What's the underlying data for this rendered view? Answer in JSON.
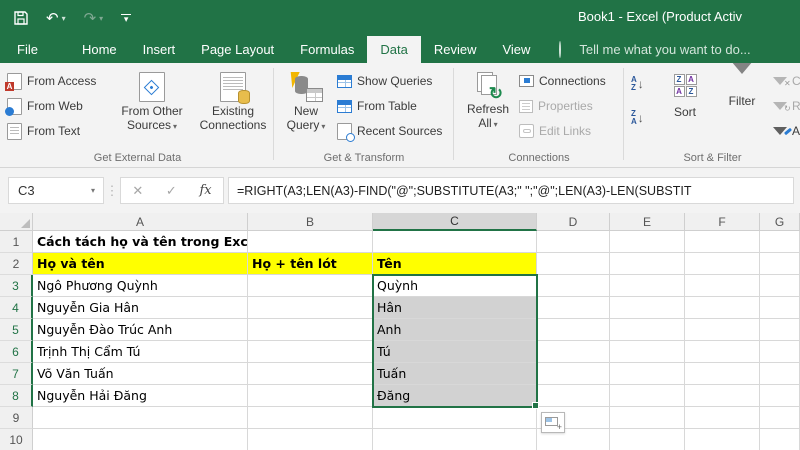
{
  "colors": {
    "accent_green": "#217346",
    "highlight_yellow": "#ffff00",
    "selection_gray": "#d2d2d2"
  },
  "window": {
    "title": "Book1 - Excel (Product Activ"
  },
  "icons": {
    "undo": "↶",
    "redo": "↷",
    "dropdown": "▾",
    "overflow_dots": "⋮",
    "cancel": "✕",
    "enter": "✓",
    "fx": "fx",
    "refresh": "↻",
    "sort_arrow": "↓",
    "letter_a": "A",
    "letter_z": "Z",
    "plus": "+",
    "clear_x": "✕"
  },
  "tabs": {
    "file": "File",
    "home": "Home",
    "insert": "Insert",
    "page_layout": "Page Layout",
    "formulas": "Formulas",
    "data": "Data",
    "review": "Review",
    "view": "View",
    "tell_me": "Tell me what you want to do..."
  },
  "ribbon": {
    "get_external": {
      "label": "Get External Data",
      "from_access": "From Access",
      "from_web": "From Web",
      "from_text": "From Text",
      "from_other_line1": "From Other",
      "from_other_line2": "Sources",
      "existing_line1": "Existing",
      "existing_line2": "Connections"
    },
    "get_transform": {
      "label": "Get & Transform",
      "new_query_line1": "New",
      "new_query_line2": "Query",
      "show_queries": "Show Queries",
      "from_table": "From Table",
      "recent_sources": "Recent Sources"
    },
    "connections": {
      "label": "Connections",
      "refresh_line1": "Refresh",
      "refresh_line2": "All",
      "connections": "Connections",
      "properties": "Properties",
      "edit_links": "Edit Links"
    },
    "sort_filter": {
      "label": "Sort & Filter",
      "sort": "Sort",
      "filter": "Filter",
      "clear": "Clear",
      "reapply": "Reapply",
      "advanced": "Advanced"
    }
  },
  "formula_bar": {
    "cell_ref": "C3",
    "formula": "=RIGHT(A3;LEN(A3)-FIND(\"@\";SUBSTITUTE(A3;\" \";\"@\";LEN(A3)-LEN(SUBSTIT"
  },
  "grid": {
    "col_headers": {
      "a": "A",
      "b": "B",
      "c": "C",
      "d": "D",
      "e": "E",
      "f": "F",
      "g": "G"
    },
    "selected_range": "C3:C8",
    "rows": [
      {
        "num": "1",
        "a": "Cách tách họ và tên trong Excel",
        "b": "",
        "c": ""
      },
      {
        "num": "2",
        "a": "Họ và tên",
        "b": "Họ + tên lót",
        "c": "Tên"
      },
      {
        "num": "3",
        "a": "Ngô Phương Quỳnh",
        "b": "",
        "c": "Quỳnh"
      },
      {
        "num": "4",
        "a": "Nguyễn Gia Hân",
        "b": "",
        "c": "Hân"
      },
      {
        "num": "5",
        "a": "Nguyễn Đào Trúc Anh",
        "b": "",
        "c": "Anh"
      },
      {
        "num": "6",
        "a": "Trịnh Thị Cẩm Tú",
        "b": "",
        "c": "Tú"
      },
      {
        "num": "7",
        "a": "Võ Văn Tuấn",
        "b": "",
        "c": "Tuấn"
      },
      {
        "num": "8",
        "a": "Nguyễn Hải Đăng",
        "b": "",
        "c": "Đăng"
      },
      {
        "num": "9",
        "a": "",
        "b": "",
        "c": ""
      },
      {
        "num": "10",
        "a": "",
        "b": "",
        "c": ""
      }
    ]
  }
}
